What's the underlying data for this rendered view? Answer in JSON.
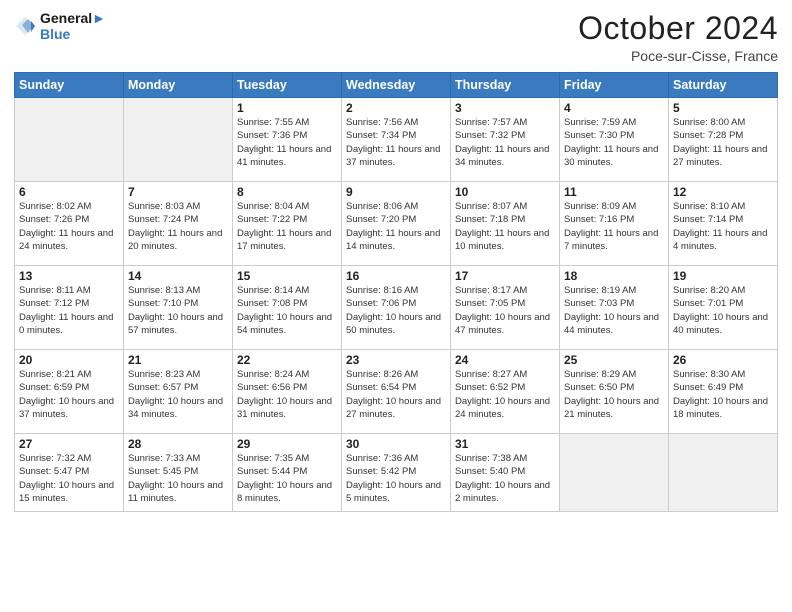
{
  "header": {
    "logo_line1": "General",
    "logo_line2": "Blue",
    "month": "October 2024",
    "location": "Poce-sur-Cisse, France"
  },
  "weekdays": [
    "Sunday",
    "Monday",
    "Tuesday",
    "Wednesday",
    "Thursday",
    "Friday",
    "Saturday"
  ],
  "weeks": [
    [
      {
        "day": "",
        "info": ""
      },
      {
        "day": "",
        "info": ""
      },
      {
        "day": "1",
        "info": "Sunrise: 7:55 AM\nSunset: 7:36 PM\nDaylight: 11 hours and 41 minutes."
      },
      {
        "day": "2",
        "info": "Sunrise: 7:56 AM\nSunset: 7:34 PM\nDaylight: 11 hours and 37 minutes."
      },
      {
        "day": "3",
        "info": "Sunrise: 7:57 AM\nSunset: 7:32 PM\nDaylight: 11 hours and 34 minutes."
      },
      {
        "day": "4",
        "info": "Sunrise: 7:59 AM\nSunset: 7:30 PM\nDaylight: 11 hours and 30 minutes."
      },
      {
        "day": "5",
        "info": "Sunrise: 8:00 AM\nSunset: 7:28 PM\nDaylight: 11 hours and 27 minutes."
      }
    ],
    [
      {
        "day": "6",
        "info": "Sunrise: 8:02 AM\nSunset: 7:26 PM\nDaylight: 11 hours and 24 minutes."
      },
      {
        "day": "7",
        "info": "Sunrise: 8:03 AM\nSunset: 7:24 PM\nDaylight: 11 hours and 20 minutes."
      },
      {
        "day": "8",
        "info": "Sunrise: 8:04 AM\nSunset: 7:22 PM\nDaylight: 11 hours and 17 minutes."
      },
      {
        "day": "9",
        "info": "Sunrise: 8:06 AM\nSunset: 7:20 PM\nDaylight: 11 hours and 14 minutes."
      },
      {
        "day": "10",
        "info": "Sunrise: 8:07 AM\nSunset: 7:18 PM\nDaylight: 11 hours and 10 minutes."
      },
      {
        "day": "11",
        "info": "Sunrise: 8:09 AM\nSunset: 7:16 PM\nDaylight: 11 hours and 7 minutes."
      },
      {
        "day": "12",
        "info": "Sunrise: 8:10 AM\nSunset: 7:14 PM\nDaylight: 11 hours and 4 minutes."
      }
    ],
    [
      {
        "day": "13",
        "info": "Sunrise: 8:11 AM\nSunset: 7:12 PM\nDaylight: 11 hours and 0 minutes."
      },
      {
        "day": "14",
        "info": "Sunrise: 8:13 AM\nSunset: 7:10 PM\nDaylight: 10 hours and 57 minutes."
      },
      {
        "day": "15",
        "info": "Sunrise: 8:14 AM\nSunset: 7:08 PM\nDaylight: 10 hours and 54 minutes."
      },
      {
        "day": "16",
        "info": "Sunrise: 8:16 AM\nSunset: 7:06 PM\nDaylight: 10 hours and 50 minutes."
      },
      {
        "day": "17",
        "info": "Sunrise: 8:17 AM\nSunset: 7:05 PM\nDaylight: 10 hours and 47 minutes."
      },
      {
        "day": "18",
        "info": "Sunrise: 8:19 AM\nSunset: 7:03 PM\nDaylight: 10 hours and 44 minutes."
      },
      {
        "day": "19",
        "info": "Sunrise: 8:20 AM\nSunset: 7:01 PM\nDaylight: 10 hours and 40 minutes."
      }
    ],
    [
      {
        "day": "20",
        "info": "Sunrise: 8:21 AM\nSunset: 6:59 PM\nDaylight: 10 hours and 37 minutes."
      },
      {
        "day": "21",
        "info": "Sunrise: 8:23 AM\nSunset: 6:57 PM\nDaylight: 10 hours and 34 minutes."
      },
      {
        "day": "22",
        "info": "Sunrise: 8:24 AM\nSunset: 6:56 PM\nDaylight: 10 hours and 31 minutes."
      },
      {
        "day": "23",
        "info": "Sunrise: 8:26 AM\nSunset: 6:54 PM\nDaylight: 10 hours and 27 minutes."
      },
      {
        "day": "24",
        "info": "Sunrise: 8:27 AM\nSunset: 6:52 PM\nDaylight: 10 hours and 24 minutes."
      },
      {
        "day": "25",
        "info": "Sunrise: 8:29 AM\nSunset: 6:50 PM\nDaylight: 10 hours and 21 minutes."
      },
      {
        "day": "26",
        "info": "Sunrise: 8:30 AM\nSunset: 6:49 PM\nDaylight: 10 hours and 18 minutes."
      }
    ],
    [
      {
        "day": "27",
        "info": "Sunrise: 7:32 AM\nSunset: 5:47 PM\nDaylight: 10 hours and 15 minutes."
      },
      {
        "day": "28",
        "info": "Sunrise: 7:33 AM\nSunset: 5:45 PM\nDaylight: 10 hours and 11 minutes."
      },
      {
        "day": "29",
        "info": "Sunrise: 7:35 AM\nSunset: 5:44 PM\nDaylight: 10 hours and 8 minutes."
      },
      {
        "day": "30",
        "info": "Sunrise: 7:36 AM\nSunset: 5:42 PM\nDaylight: 10 hours and 5 minutes."
      },
      {
        "day": "31",
        "info": "Sunrise: 7:38 AM\nSunset: 5:40 PM\nDaylight: 10 hours and 2 minutes."
      },
      {
        "day": "",
        "info": ""
      },
      {
        "day": "",
        "info": ""
      }
    ]
  ]
}
